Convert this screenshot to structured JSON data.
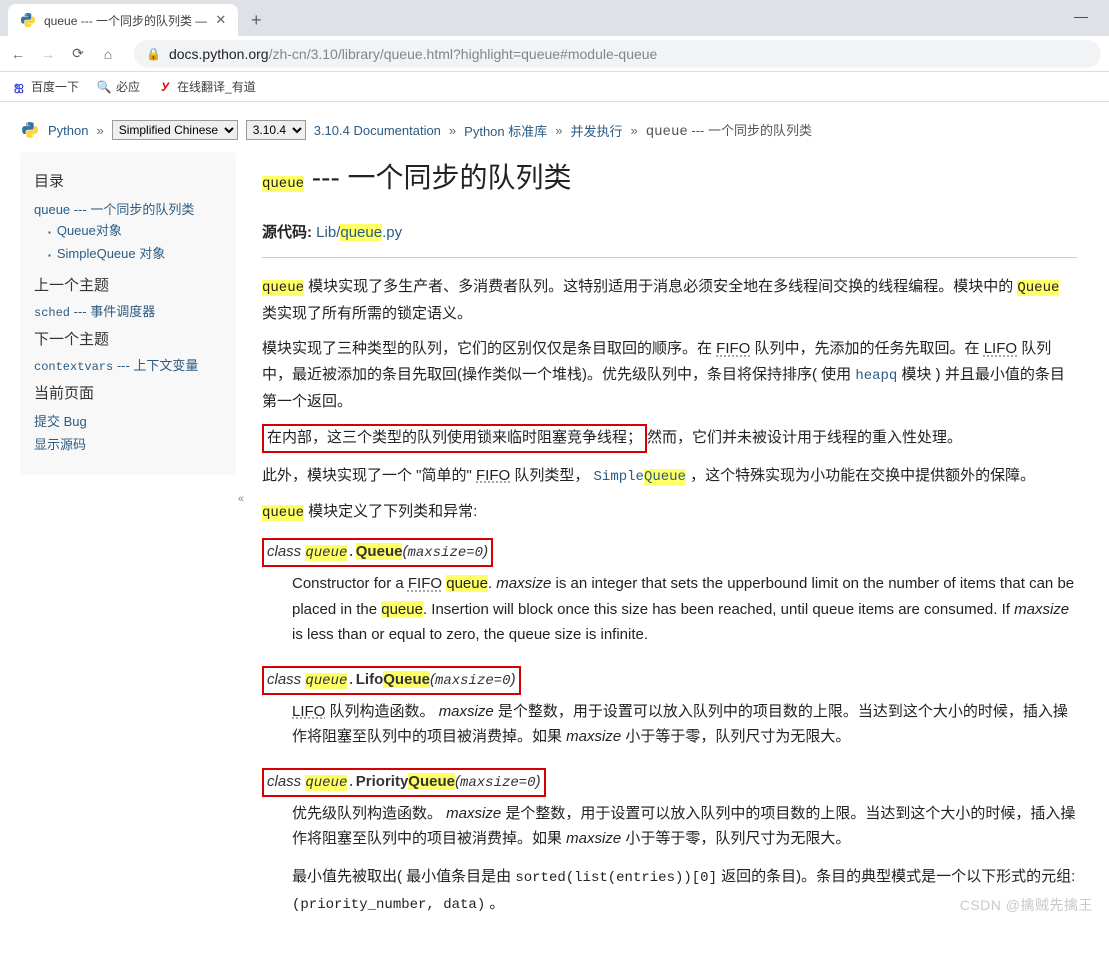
{
  "browser": {
    "tab_title": "queue --- 一个同步的队列类 —",
    "url_host": "docs.python.org",
    "url_path": "/zh-cn/3.10/library/queue.html?highlight=queue#module-queue"
  },
  "bookmarks": {
    "baidu": "百度一下",
    "bing": "必应",
    "youdao": "在线翻译_有道"
  },
  "relbar": {
    "python": "Python",
    "lang_selected": "Simplified Chinese",
    "lang_options": [
      "Simplified Chinese"
    ],
    "ver_selected": "3.10.4",
    "ver_options": [
      "3.10.4"
    ],
    "doc": "3.10.4 Documentation",
    "stdlib": "Python 标准库",
    "concur": "并发执行",
    "current_code": "queue",
    "current_rest": " --- 一个同步的队列类",
    "sep": "»"
  },
  "sidebar": {
    "toc_title": "目录",
    "toc_top": "queue --- 一个同步的队列类",
    "toc_sub1": "Queue对象",
    "toc_sub2": "SimpleQueue 对象",
    "prev_title": "上一个主题",
    "prev_code": "sched",
    "prev_rest": " --- 事件调度器",
    "next_title": "下一个主题",
    "next_code": "contextvars",
    "next_rest": " --- 上下文变量",
    "thispage_title": "当前页面",
    "bug": "提交 Bug",
    "src": "显示源码",
    "collapse": "«"
  },
  "content": {
    "h1_hl": "queue",
    "h1_rest": " --- 一个同步的队列类",
    "src_label": "源代码:",
    "src_pre": "Lib/",
    "src_hl": "queue",
    "src_post": ".py",
    "p1_hl1": "queue",
    "p1_seg1": " 模块实现了多生产者、多消费者队列。这特别适用于消息必须安全地在多线程间交换的线程编程。模块中的 ",
    "p1_hl2": "Queue",
    "p1_seg2": " 类实现了所有所需的锁定语义。",
    "p2_seg1": "模块实现了三种类型的队列，它们的区别仅仅是条目取回的顺序。在 ",
    "p2_fifo": "FIFO",
    "p2_seg2": " 队列中，先添加的任务先取回。在 ",
    "p2_lifo": "LIFO",
    "p2_seg3": " 队列中，最近被添加的条目先取回(操作类似一个堆栈)。优先级队列中，条目将保持排序( 使用 ",
    "p2_link": "heapq",
    "p2_seg4": " 模块 ) 并且最小值的条目第一个返回。",
    "p3_boxed": "在内部，这三个类型的队列使用锁来临时阻塞竞争线程；",
    "p3_rest": "然而，它们并未被设计用于线程的重入性处理。",
    "p4_seg1": "此外，模块实现了一个 \"简单的\" ",
    "p4_fifo": "FIFO",
    "p4_seg2": " 队列类型，  ",
    "p4_link_pre": "Simple",
    "p4_link_hl": "Queue",
    "p4_seg3": " ，这个特殊实现为小功能在交换中提供额外的保障。",
    "p5_hl": "queue",
    "p5_rest": " 模块定义了下列类和异常:",
    "cls1": {
      "kw": "class ",
      "mod": "queue",
      "dot": ".",
      "name_pre": "",
      "name_hl": "Queue",
      "sig_open": "(",
      "sig_param": "maxsize=0",
      "sig_close": ")",
      "desc_1": "Constructor for a ",
      "desc_fifo": "FIFO",
      "desc_sp1": " ",
      "desc_hl1": "queue",
      "desc_2": ". ",
      "desc_em1": "maxsize",
      "desc_3": " is an integer that sets the upperbound limit on the number of items that can be placed in the ",
      "desc_hl2": "queue",
      "desc_4": ". Insertion will block once this size has been reached, until queue items are consumed. If ",
      "desc_em2": "maxsize",
      "desc_5": " is less than or equal to zero, the queue size is infinite."
    },
    "cls2": {
      "kw": "class ",
      "mod": "queue",
      "dot": ".",
      "name_pre": "Lifo",
      "name_hl": "Queue",
      "sig_open": "(",
      "sig_param": "maxsize=0",
      "sig_close": ")",
      "desc_lifo": "LIFO",
      "desc_1": " 队列构造函数。 ",
      "desc_em1": "maxsize",
      "desc_2": " 是个整数，用于设置可以放入队列中的项目数的上限。当达到这个大小的时候，插入操作将阻塞至队列中的项目被消费掉。如果 ",
      "desc_em2": "maxsize",
      "desc_3": " 小于等于零，队列尺寸为无限大。"
    },
    "cls3": {
      "kw": "class ",
      "mod": "queue",
      "dot": ".",
      "name_pre": "Priority",
      "name_hl": "Queue",
      "sig_open": "(",
      "sig_param": "maxsize=0",
      "sig_close": ")",
      "desc_1": "优先级队列构造函数。 ",
      "desc_em1": "maxsize",
      "desc_2": " 是个整数，用于设置可以放入队列中的项目数的上限。当达到这个大小的时候，插入操作将阻塞至队列中的项目被消费掉。如果 ",
      "desc_em2": "maxsize",
      "desc_3": " 小于等于零，队列尺寸为无限大。",
      "desc_p2a": "最小值先被取出( 最小值条目是由 ",
      "desc_code": "sorted(list(entries))[0]",
      "desc_p2b": " 返回的条目)。条目的典型模式是一个以下形式的元组:  ",
      "desc_code2": "(priority_number, data)",
      "desc_p2c": " 。"
    }
  },
  "watermark": "CSDN @擒贼先擒王"
}
